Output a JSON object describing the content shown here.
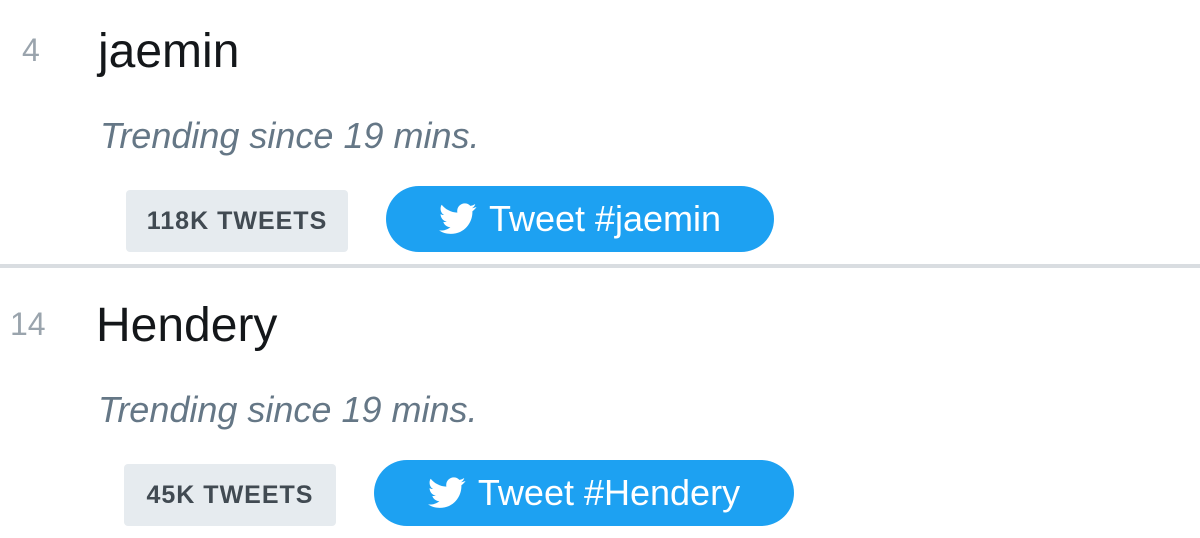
{
  "trends": [
    {
      "rank": "4",
      "name": "jaemin",
      "since": "Trending since 19 mins.",
      "tweet_count": "118K TWEETS",
      "tweet_button": "Tweet #jaemin"
    },
    {
      "rank": "14",
      "name": "Hendery",
      "since": "Trending since 19 mins.",
      "tweet_count": "45K TWEETS",
      "tweet_button": "Tweet #Hendery"
    }
  ],
  "colors": {
    "accent": "#1da1f2",
    "badge_bg": "#e6ebef",
    "muted_text": "#657786",
    "rank_text": "#9aa4ad",
    "divider": "#d9dde1"
  },
  "icons": {
    "tweet_button_icon": "twitter-bird-icon"
  }
}
